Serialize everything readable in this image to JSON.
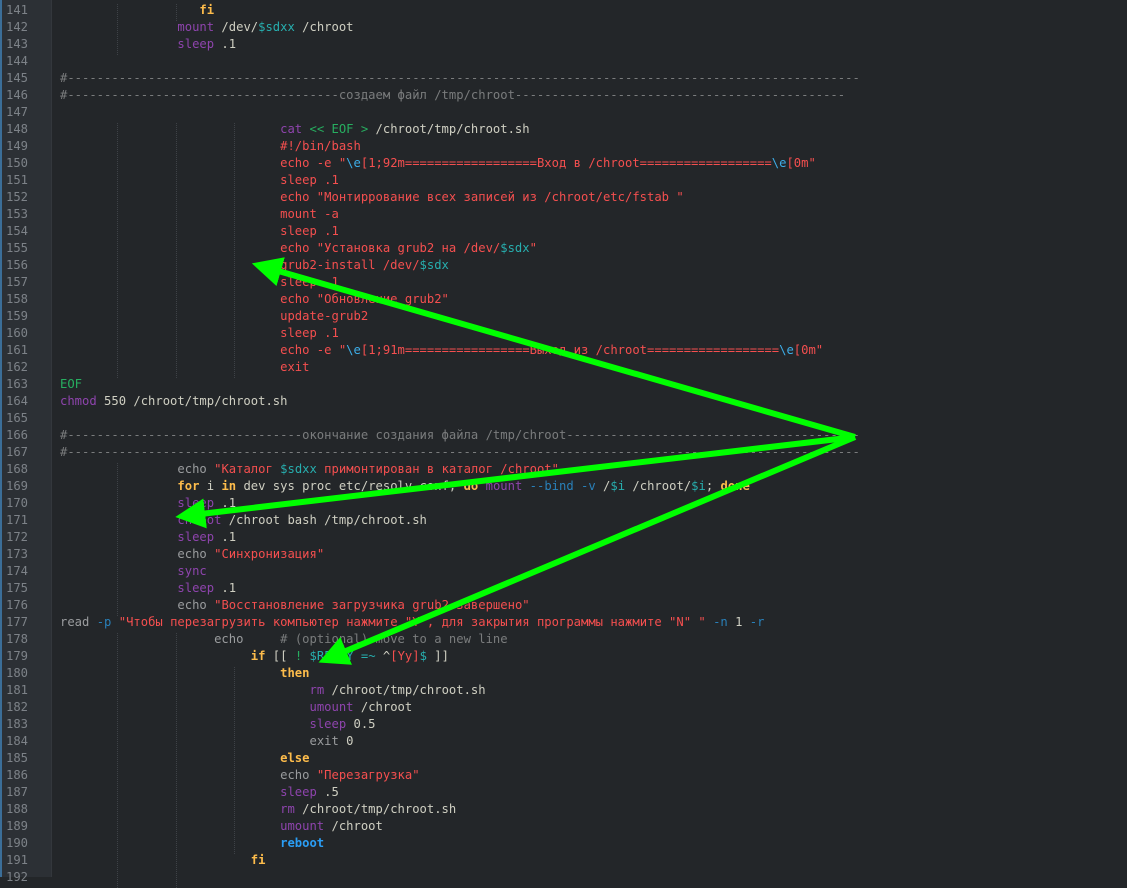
{
  "editor": {
    "colors": {
      "background": "#232629",
      "gutter": "#2c3035",
      "arrow": "#00ff00"
    },
    "lines": [
      {
        "n": "141",
        "t": [
          [
            "k",
            "                   fi"
          ]
        ]
      },
      {
        "n": "142",
        "t": [
          [
            "n",
            "                "
          ],
          [
            "f",
            "mount"
          ],
          [
            "n",
            " /dev/"
          ],
          [
            "v",
            "$sdxx"
          ],
          [
            "n",
            " /chroot"
          ]
        ]
      },
      {
        "n": "143",
        "t": [
          [
            "n",
            "                "
          ],
          [
            "f",
            "sleep"
          ],
          [
            "n",
            " .1"
          ]
        ]
      },
      {
        "n": "144",
        "t": []
      },
      {
        "n": "145",
        "t": [
          [
            "c",
            "#------------------------------------------------------------------------------------------------------------"
          ]
        ]
      },
      {
        "n": "146",
        "t": [
          [
            "c",
            "#-------------------------------------создаем файл /tmp/chroot---------------------------------------------"
          ]
        ]
      },
      {
        "n": "147",
        "t": []
      },
      {
        "n": "148",
        "t": [
          [
            "n",
            "                              "
          ],
          [
            "f",
            "cat"
          ],
          [
            "n",
            " "
          ],
          [
            "g",
            "<< EOF >"
          ],
          [
            "n",
            " /chroot/tmp/chroot.sh"
          ]
        ]
      },
      {
        "n": "149",
        "t": [
          [
            "s",
            "                              #!/bin/bash"
          ]
        ]
      },
      {
        "n": "150",
        "t": [
          [
            "s",
            "                              echo -e \""
          ],
          [
            "e",
            "\\e"
          ],
          [
            "s",
            "[1;92m==================Вход в /chroot=================="
          ],
          [
            "e",
            "\\e"
          ],
          [
            "s",
            "[0m\""
          ]
        ]
      },
      {
        "n": "151",
        "t": [
          [
            "s",
            "                              sleep .1"
          ]
        ]
      },
      {
        "n": "152",
        "t": [
          [
            "s",
            "                              echo \"Монтиррование всех записей из /chroot/etc/fstab \""
          ]
        ]
      },
      {
        "n": "153",
        "t": [
          [
            "s",
            "                              mount -a"
          ]
        ]
      },
      {
        "n": "154",
        "t": [
          [
            "s",
            "                              sleep .1"
          ]
        ]
      },
      {
        "n": "155",
        "t": [
          [
            "s",
            "                              echo \"Установка grub2 на /dev/"
          ],
          [
            "v",
            "$sdx"
          ],
          [
            "s",
            "\""
          ]
        ]
      },
      {
        "n": "156",
        "t": [
          [
            "s",
            "                              grub2-install /dev/"
          ],
          [
            "v",
            "$sdx"
          ]
        ]
      },
      {
        "n": "157",
        "t": [
          [
            "s",
            "                              sleep .1"
          ]
        ]
      },
      {
        "n": "158",
        "t": [
          [
            "s",
            "                              echo \"Обновление grub2\""
          ]
        ]
      },
      {
        "n": "159",
        "t": [
          [
            "s",
            "                              update-grub2"
          ]
        ]
      },
      {
        "n": "160",
        "t": [
          [
            "s",
            "                              sleep .1"
          ]
        ]
      },
      {
        "n": "161",
        "t": [
          [
            "s",
            "                              echo -e \""
          ],
          [
            "e",
            "\\e"
          ],
          [
            "s",
            "[1;91m=================Выход из /chroot=================="
          ],
          [
            "e",
            "\\e"
          ],
          [
            "s",
            "[0m\""
          ]
        ]
      },
      {
        "n": "162",
        "t": [
          [
            "s",
            "                              exit"
          ]
        ]
      },
      {
        "n": "163",
        "t": [
          [
            "g",
            "EOF"
          ]
        ]
      },
      {
        "n": "164",
        "t": [
          [
            "f",
            "chmod"
          ],
          [
            "n",
            " 550 /chroot/tmp/chroot.sh"
          ]
        ]
      },
      {
        "n": "165",
        "t": []
      },
      {
        "n": "166",
        "t": [
          [
            "c",
            "#--------------------------------окончание создания файла /tmp/chroot----------------------------------------"
          ]
        ]
      },
      {
        "n": "167",
        "t": [
          [
            "c",
            "#------------------------------------------------------------------------------------------------------------"
          ]
        ]
      },
      {
        "n": "168",
        "t": [
          [
            "n",
            "                "
          ],
          [
            "b",
            "echo"
          ],
          [
            "n",
            " "
          ],
          [
            "s",
            "\"Каталог "
          ],
          [
            "v",
            "$sdxx"
          ],
          [
            "s",
            " примонтирован в каталог /chroot\""
          ]
        ]
      },
      {
        "n": "169",
        "t": [
          [
            "n",
            "                "
          ],
          [
            "k",
            "for"
          ],
          [
            "n",
            " i "
          ],
          [
            "k",
            "in"
          ],
          [
            "n",
            " dev sys proc etc/resolv.conf; "
          ],
          [
            "k",
            "do"
          ],
          [
            "n",
            " "
          ],
          [
            "f",
            "mount"
          ],
          [
            "n",
            " "
          ],
          [
            "o",
            "--bind -v"
          ],
          [
            "n",
            " /"
          ],
          [
            "v",
            "$i"
          ],
          [
            "n",
            " /chroot/"
          ],
          [
            "v",
            "$i"
          ],
          [
            "n",
            "; "
          ],
          [
            "k",
            "done"
          ]
        ]
      },
      {
        "n": "170",
        "t": [
          [
            "n",
            "                "
          ],
          [
            "f",
            "sleep"
          ],
          [
            "n",
            " .1"
          ]
        ]
      },
      {
        "n": "171",
        "t": [
          [
            "n",
            "                "
          ],
          [
            "f",
            "chroot"
          ],
          [
            "n",
            " /chroot bash /tmp/chroot.sh"
          ]
        ]
      },
      {
        "n": "172",
        "t": [
          [
            "n",
            "                "
          ],
          [
            "f",
            "sleep"
          ],
          [
            "n",
            " .1"
          ]
        ]
      },
      {
        "n": "173",
        "t": [
          [
            "n",
            "                "
          ],
          [
            "b",
            "echo"
          ],
          [
            "n",
            " "
          ],
          [
            "s",
            "\"Синхронизация\""
          ]
        ]
      },
      {
        "n": "174",
        "t": [
          [
            "n",
            "                "
          ],
          [
            "f",
            "sync"
          ]
        ]
      },
      {
        "n": "175",
        "t": [
          [
            "n",
            "                "
          ],
          [
            "f",
            "sleep"
          ],
          [
            "n",
            " .1"
          ]
        ]
      },
      {
        "n": "176",
        "t": [
          [
            "n",
            "                "
          ],
          [
            "b",
            "echo"
          ],
          [
            "n",
            " "
          ],
          [
            "s",
            "\"Восстановление загрузчика grub2 завершено\""
          ]
        ]
      },
      {
        "n": "177",
        "t": [
          [
            "b",
            "read"
          ],
          [
            "n",
            " "
          ],
          [
            "o",
            "-p"
          ],
          [
            "n",
            " "
          ],
          [
            "s",
            "\"Чтобы перезагрузить компьютер нажмите \"Y\", для закрытия программы нажмите \"N\" \""
          ],
          [
            "n",
            " "
          ],
          [
            "o",
            "-n"
          ],
          [
            "n",
            " 1 "
          ],
          [
            "o",
            "-r"
          ]
        ]
      },
      {
        "n": "178",
        "t": [
          [
            "n",
            "                     "
          ],
          [
            "b",
            "echo"
          ],
          [
            "n",
            "     "
          ],
          [
            "c",
            "# (optional) move to a new line"
          ]
        ]
      },
      {
        "n": "179",
        "t": [
          [
            "n",
            "                          "
          ],
          [
            "k",
            "if"
          ],
          [
            "n",
            " [[ "
          ],
          [
            "g",
            "!"
          ],
          [
            "n",
            " "
          ],
          [
            "v",
            "$REPLY =~"
          ],
          [
            "n",
            " ^"
          ],
          [
            "s",
            "[Yy]"
          ],
          [
            "v",
            "$"
          ],
          [
            "n",
            " ]]"
          ]
        ]
      },
      {
        "n": "180",
        "t": [
          [
            "n",
            "                              "
          ],
          [
            "k",
            "then"
          ]
        ]
      },
      {
        "n": "181",
        "t": [
          [
            "n",
            "                                  "
          ],
          [
            "f",
            "rm"
          ],
          [
            "n",
            " /chroot/tmp/chroot.sh"
          ]
        ]
      },
      {
        "n": "182",
        "t": [
          [
            "n",
            "                                  "
          ],
          [
            "f",
            "umount"
          ],
          [
            "n",
            " /chroot"
          ]
        ]
      },
      {
        "n": "183",
        "t": [
          [
            "n",
            "                                  "
          ],
          [
            "f",
            "sleep"
          ],
          [
            "n",
            " 0.5"
          ]
        ]
      },
      {
        "n": "184",
        "t": [
          [
            "n",
            "                                  "
          ],
          [
            "b",
            "exit"
          ],
          [
            "n",
            " 0"
          ]
        ]
      },
      {
        "n": "185",
        "t": [
          [
            "n",
            "                              "
          ],
          [
            "k",
            "else"
          ]
        ]
      },
      {
        "n": "186",
        "t": [
          [
            "n",
            "                              "
          ],
          [
            "b",
            "echo"
          ],
          [
            "n",
            " "
          ],
          [
            "s",
            "\"Перезагрузка\""
          ]
        ]
      },
      {
        "n": "187",
        "t": [
          [
            "n",
            "                              "
          ],
          [
            "f",
            "sleep"
          ],
          [
            "n",
            " .5"
          ]
        ]
      },
      {
        "n": "188",
        "t": [
          [
            "n",
            "                              "
          ],
          [
            "f",
            "rm"
          ],
          [
            "n",
            " /chroot/tmp/chroot.sh"
          ]
        ]
      },
      {
        "n": "189",
        "t": [
          [
            "n",
            "                              "
          ],
          [
            "f",
            "umount"
          ],
          [
            "n",
            " /chroot"
          ]
        ]
      },
      {
        "n": "190",
        "t": [
          [
            "n",
            "                              "
          ],
          [
            "r",
            "reboot"
          ]
        ]
      },
      {
        "n": "191",
        "t": [
          [
            "k",
            "                          fi"
          ]
        ]
      },
      {
        "n": "192",
        "t": []
      }
    ]
  },
  "annotations": {
    "arrow_icons": [
      "arrow-to-line-156",
      "arrow-to-line-171",
      "arrow-to-line-179"
    ]
  }
}
